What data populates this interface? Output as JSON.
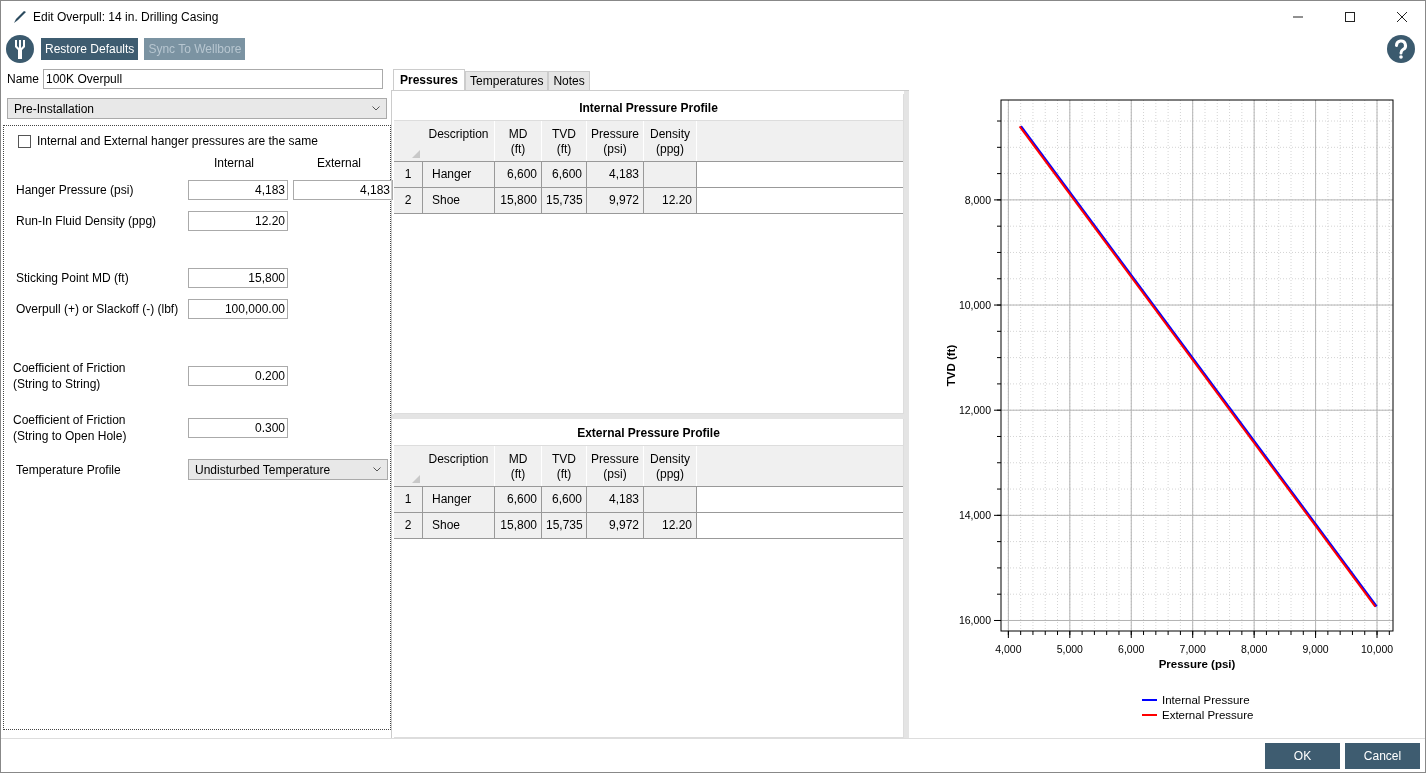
{
  "window": {
    "title": "Edit Overpull: 14 in. Drilling Casing"
  },
  "toolbar": {
    "buttons": [
      {
        "label": "Restore Defaults",
        "disabled": false
      },
      {
        "label": "Sync To Wellbore",
        "disabled": true
      }
    ]
  },
  "name_field": {
    "label": "Name",
    "value": "100K Overpull"
  },
  "phase_dropdown": {
    "value": "Pre-Installation"
  },
  "same_pressures": {
    "label": "Internal and External hanger pressures are the same",
    "checked": false
  },
  "columns": [
    "Internal",
    "External"
  ],
  "groups": [
    [
      {
        "kind": "input",
        "label": "Hanger Pressure (psi)",
        "values": [
          "4,183",
          "4,183"
        ]
      },
      {
        "kind": "input",
        "label": "Run-In Fluid Density (ppg)",
        "values": [
          "12.20"
        ]
      }
    ],
    [
      {
        "kind": "input",
        "label": "Sticking Point MD (ft)",
        "values": [
          "15,800"
        ]
      },
      {
        "kind": "input",
        "label": "Overpull (+) or Slackoff (-) (lbf)",
        "values": [
          "100,000.00"
        ]
      }
    ],
    [
      {
        "kind": "input",
        "label": "Coefficient of Friction\n(String to String)",
        "values": [
          "0.200"
        ]
      },
      {
        "kind": "input",
        "label": "Coefficient of Friction\n(String to Open Hole)",
        "values": [
          "0.300"
        ]
      },
      {
        "kind": "dropdown",
        "label": "Temperature Profile",
        "values": [
          "Undisturbed Temperature"
        ]
      }
    ]
  ],
  "tabs": [
    {
      "label": "Pressures",
      "selected": true
    },
    {
      "label": "Temperatures",
      "selected": false
    },
    {
      "label": "Notes",
      "selected": false
    }
  ],
  "tables": [
    {
      "title": "Internal Pressure Profile",
      "columns": [
        "Description",
        "MD\n(ft)",
        "TVD\n(ft)",
        "Pressure\n(psi)",
        "Density\n(ppg)"
      ],
      "rows": [
        {
          "number": "1",
          "cells": [
            "Hanger",
            "6,600",
            "6,600",
            "4,183",
            null
          ]
        },
        {
          "number": "2",
          "cells": [
            "Shoe",
            "15,800",
            "15,735",
            "9,972",
            "12.20"
          ]
        }
      ]
    },
    {
      "title": "External Pressure Profile",
      "columns": [
        "Description",
        "MD\n(ft)",
        "TVD\n(ft)",
        "Pressure\n(psi)",
        "Density\n(ppg)"
      ],
      "rows": [
        {
          "number": "1",
          "cells": [
            "Hanger",
            "6,600",
            "6,600",
            "4,183",
            null
          ]
        },
        {
          "number": "2",
          "cells": [
            "Shoe",
            "15,800",
            "15,735",
            "9,972",
            "12.20"
          ]
        }
      ]
    }
  ],
  "chart": {
    "chart_data": {
      "type": "line",
      "xlabel": "Pressure (psi)",
      "ylabel": "TVD (ft)",
      "x": [
        4183,
        9972
      ],
      "series": [
        {
          "name": "Internal Pressure",
          "color": "#0000ff",
          "values": [
            6600,
            15735
          ]
        },
        {
          "name": "External Pressure",
          "color": "#ff0000",
          "values": [
            6600,
            15735
          ]
        }
      ],
      "grid": true,
      "legend": true,
      "xlim": [
        3880,
        10260
      ],
      "ylim": [
        16200,
        6100
      ],
      "xticks": [
        {
          "value": 4000,
          "label": "4,000"
        },
        {
          "value": 5000,
          "label": "5,000"
        },
        {
          "value": 6000,
          "label": "6,000"
        },
        {
          "value": 7000,
          "label": "7,000"
        },
        {
          "value": 8000,
          "label": "8,000"
        },
        {
          "value": 9000,
          "label": "9,000"
        },
        {
          "value": 10000,
          "label": "10,000"
        }
      ],
      "yticks": [
        {
          "value": 8000,
          "label": "8,000"
        },
        {
          "value": 10000,
          "label": "10,000"
        },
        {
          "value": 12000,
          "label": "12,000"
        },
        {
          "value": 14000,
          "label": "14,000"
        },
        {
          "value": 16000,
          "label": "16,000"
        }
      ]
    }
  },
  "footer_buttons": [
    "OK",
    "Cancel"
  ]
}
